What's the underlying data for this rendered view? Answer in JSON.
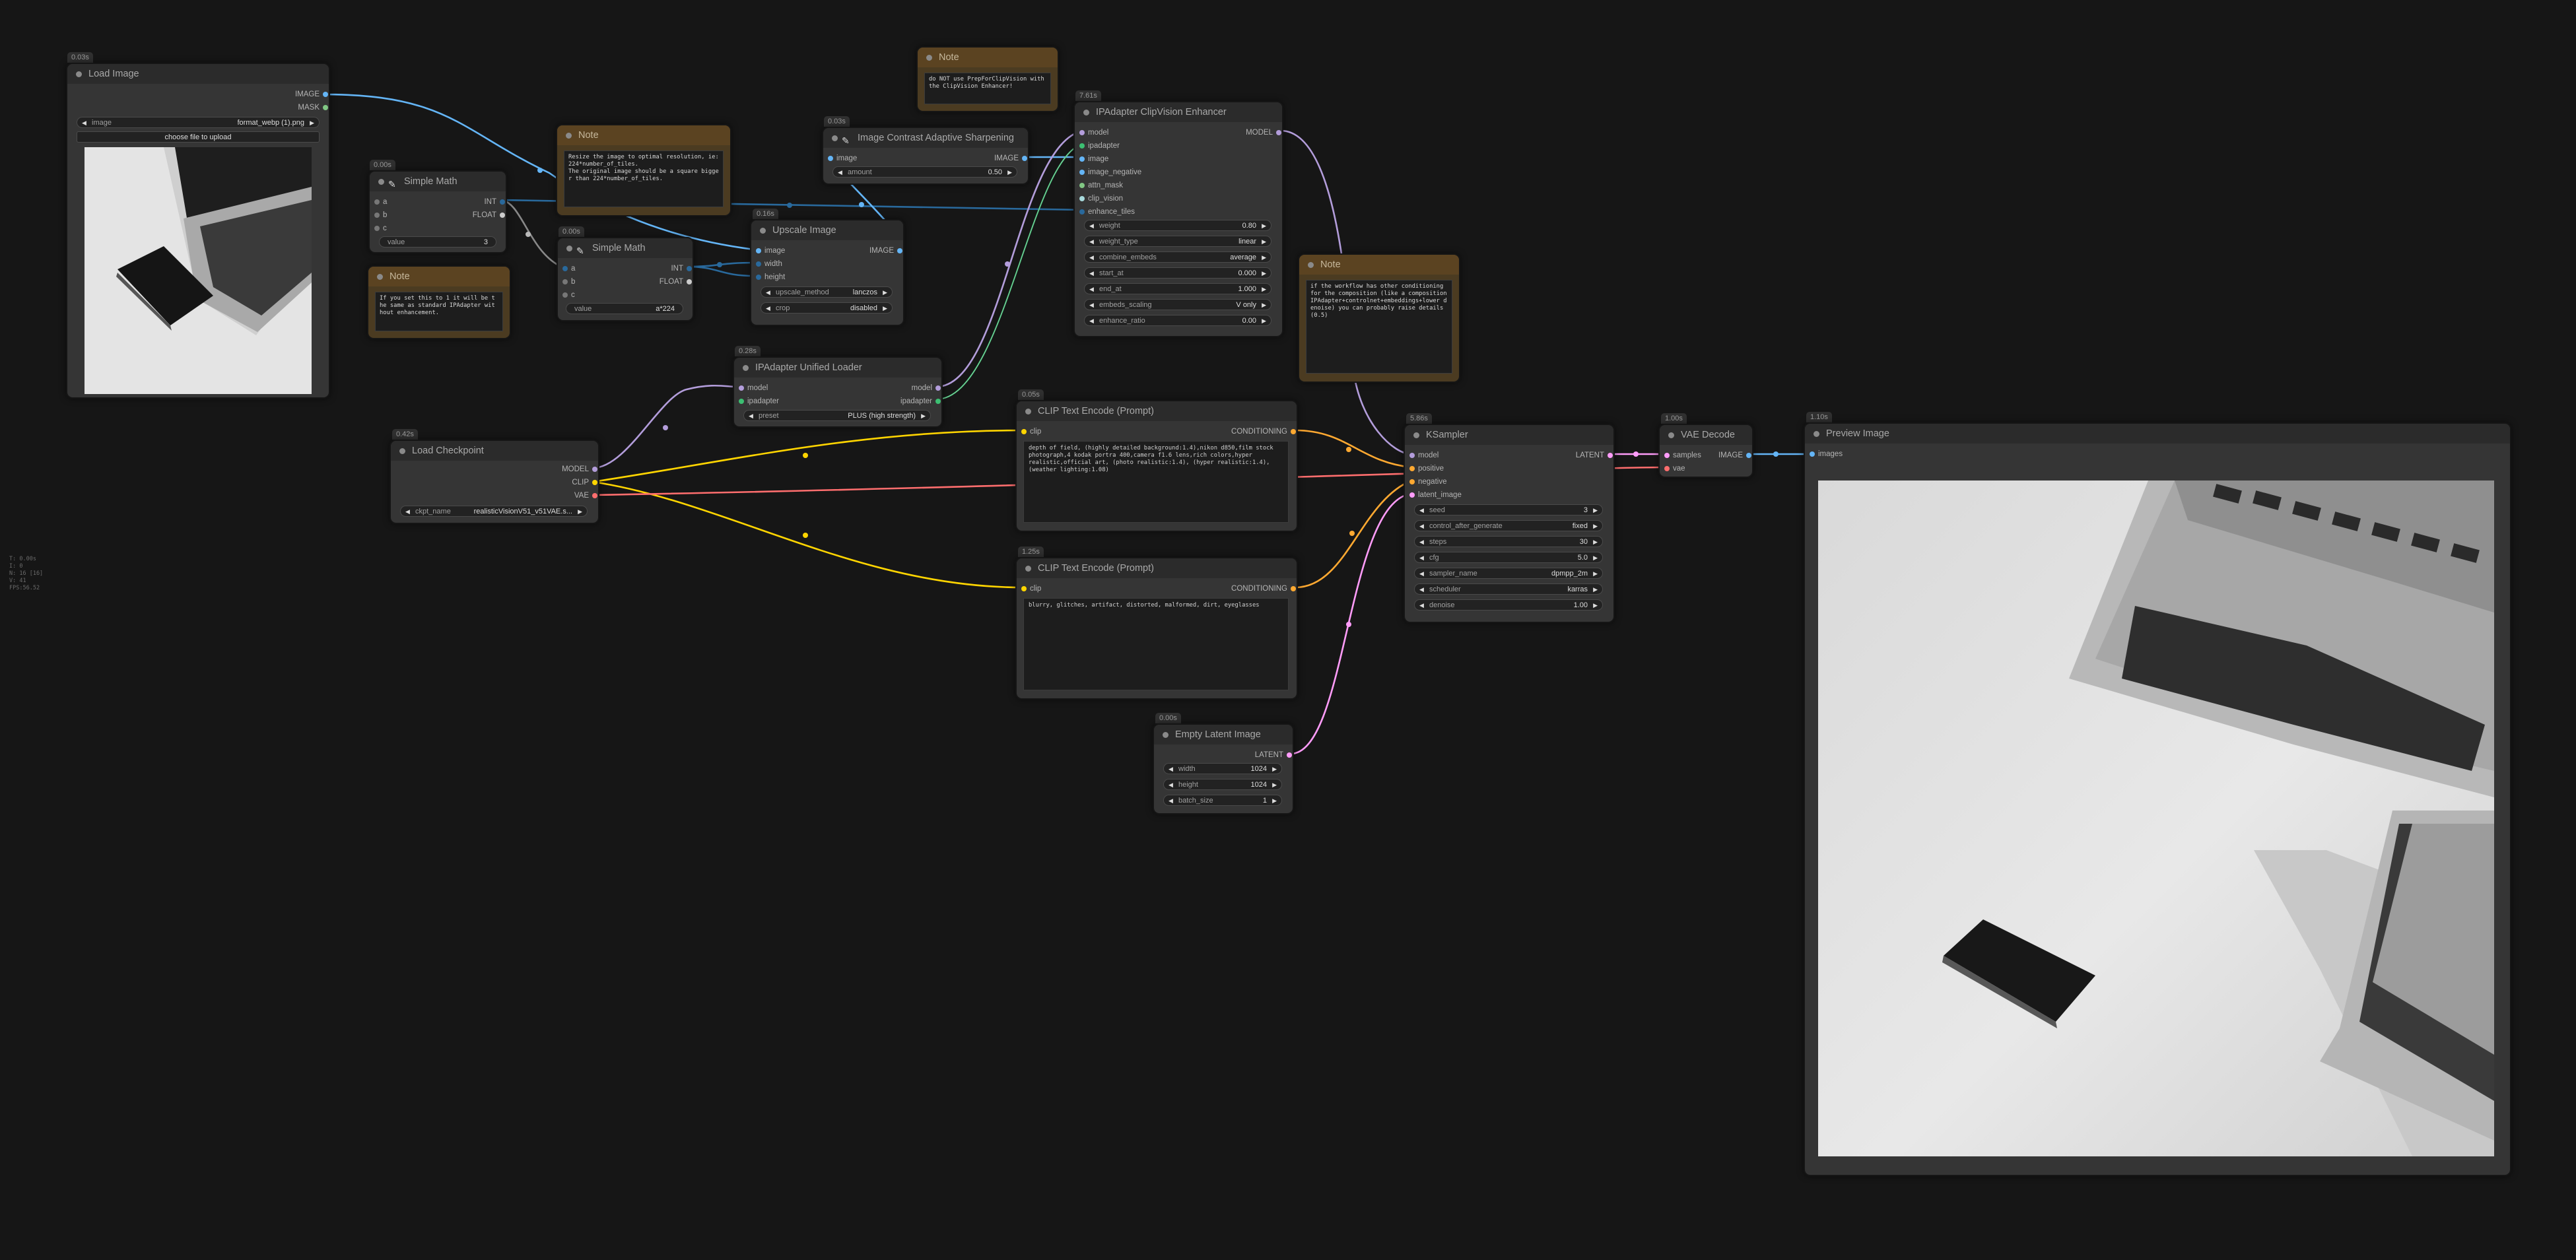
{
  "stats": {
    "lines": [
      "T: 0.00s",
      "I: 0",
      "N: 16 [16]",
      "V: 41",
      "FPS:56.52"
    ]
  },
  "nodes": {
    "load_image": {
      "timing": "0.03s",
      "title": "Load Image",
      "outputs": [
        "IMAGE",
        "MASK"
      ],
      "image_label": "image",
      "image_value": "format_webp (1).png",
      "upload_label": "choose file to upload"
    },
    "simple_math_1": {
      "timing": "0.00s",
      "title": "Simple Math",
      "inputs": [
        "a",
        "b",
        "c"
      ],
      "outputs": [
        "INT",
        "FLOAT"
      ],
      "value_label": "value",
      "value": "3"
    },
    "simple_math_2": {
      "timing": "0.00s",
      "title": "Simple Math",
      "inputs": [
        "a",
        "b",
        "c"
      ],
      "outputs": [
        "INT",
        "FLOAT"
      ],
      "value_label": "value",
      "value": "a*224"
    },
    "upscale_image": {
      "timing": "0.16s",
      "title": "Upscale Image",
      "inputs": [
        "image",
        "width",
        "height"
      ],
      "outputs": [
        "IMAGE"
      ],
      "widgets": [
        {
          "label": "upscale_method",
          "value": "lanczos"
        },
        {
          "label": "crop",
          "value": "disabled"
        }
      ]
    },
    "sharpening": {
      "timing": "0.03s",
      "title": "Image Contrast Adaptive Sharpening",
      "inputs": [
        "image"
      ],
      "outputs": [
        "IMAGE"
      ],
      "widgets": [
        {
          "label": "amount",
          "value": "0.50"
        }
      ]
    },
    "clipvision": {
      "timing": "7.61s",
      "title": "IPAdapter ClipVision Enhancer",
      "inputs": [
        "model",
        "ipadapter",
        "image",
        "image_negative",
        "attn_mask",
        "clip_vision",
        "enhance_tiles"
      ],
      "outputs": [
        "MODEL"
      ],
      "widgets": [
        {
          "label": "weight",
          "value": "0.80"
        },
        {
          "label": "weight_type",
          "value": "linear"
        },
        {
          "label": "combine_embeds",
          "value": "average"
        },
        {
          "label": "start_at",
          "value": "0.000"
        },
        {
          "label": "end_at",
          "value": "1.000"
        },
        {
          "label": "embeds_scaling",
          "value": "V only"
        },
        {
          "label": "enhance_ratio",
          "value": "0.00"
        }
      ]
    },
    "unified_loader": {
      "timing": "0.28s",
      "title": "IPAdapter Unified Loader",
      "inputs": [
        "model",
        "ipadapter"
      ],
      "outputs": [
        "model",
        "ipadapter"
      ],
      "widgets": [
        {
          "label": "preset",
          "value": "PLUS (high strength)"
        }
      ]
    },
    "load_checkpoint": {
      "timing": "0.42s",
      "title": "Load Checkpoint",
      "outputs": [
        "MODEL",
        "CLIP",
        "VAE"
      ],
      "widgets": [
        {
          "label": "ckpt_name",
          "value": "realisticVisionV51_v51VAE.s..."
        }
      ]
    },
    "clip_pos": {
      "timing": "0.05s",
      "title": "CLIP Text Encode (Prompt)",
      "inputs": [
        "clip"
      ],
      "outputs": [
        "CONDITIONING"
      ],
      "text": "depth of field, (highly detailed background:1.4),nikon d850,film stock photograph,4 kodak portra 400,camera f1.6 lens,rich colors,hyper realistic,official art, (photo realistic:1.4), (hyper realistic:1.4),(weather lighting:1.08)"
    },
    "clip_neg": {
      "timing": "1.25s",
      "title": "CLIP Text Encode (Prompt)",
      "inputs": [
        "clip"
      ],
      "outputs": [
        "CONDITIONING"
      ],
      "text": "blurry, glitches, artifact, distorted, malformed, dirt, eyeglasses"
    },
    "ksampler": {
      "timing": "5.86s",
      "title": "KSampler",
      "inputs": [
        "model",
        "positive",
        "negative",
        "latent_image"
      ],
      "outputs": [
        "LATENT"
      ],
      "widgets": [
        {
          "label": "seed",
          "value": "3"
        },
        {
          "label": "control_after_generate",
          "value": "fixed"
        },
        {
          "label": "steps",
          "value": "30"
        },
        {
          "label": "cfg",
          "value": "5.0"
        },
        {
          "label": "sampler_name",
          "value": "dpmpp_2m"
        },
        {
          "label": "scheduler",
          "value": "karras"
        },
        {
          "label": "denoise",
          "value": "1.00"
        }
      ]
    },
    "vae_decode": {
      "timing": "1.00s",
      "title": "VAE Decode",
      "inputs": [
        "samples",
        "vae"
      ],
      "outputs": [
        "IMAGE"
      ]
    },
    "empty_latent": {
      "timing": "0.00s",
      "title": "Empty Latent Image",
      "outputs": [
        "LATENT"
      ],
      "widgets": [
        {
          "label": "width",
          "value": "1024"
        },
        {
          "label": "height",
          "value": "1024"
        },
        {
          "label": "batch_size",
          "value": "1"
        }
      ]
    },
    "preview": {
      "timing": "1.10s",
      "title": "Preview Image",
      "inputs": [
        "images"
      ]
    }
  },
  "notes": {
    "note_resize": {
      "title": "Note",
      "text": "Resize the image to optimal resolution, ie: 224*number_of_tiles.\nThe original image should be a square bigger than 224*number_of_tiles."
    },
    "note_c": {
      "title": "Note",
      "text": "If you set this to 1 it will be the same as standard IPAdapter without enhancement."
    },
    "note_top": {
      "title": "Note",
      "text": "do NOT use PrepForClipVision with the ClipVision Enhancer!"
    },
    "note_right": {
      "title": "Note",
      "text": "if the workflow has other conditioning for the composition (like a composition IPAdapter+controlnet+embeddings+lower denoise) you can probably raise details (0.5)"
    }
  },
  "colors": {
    "image": "#64b5f6",
    "int": "#29699c",
    "model": "#b39ddb",
    "clip": "#ffd500",
    "conditioning": "#ffa931",
    "latent": "#ff9cf9",
    "vae": "#ff6e6e",
    "ipadapter": "#3cbf72",
    "clip_vision": "#a8dadc"
  }
}
